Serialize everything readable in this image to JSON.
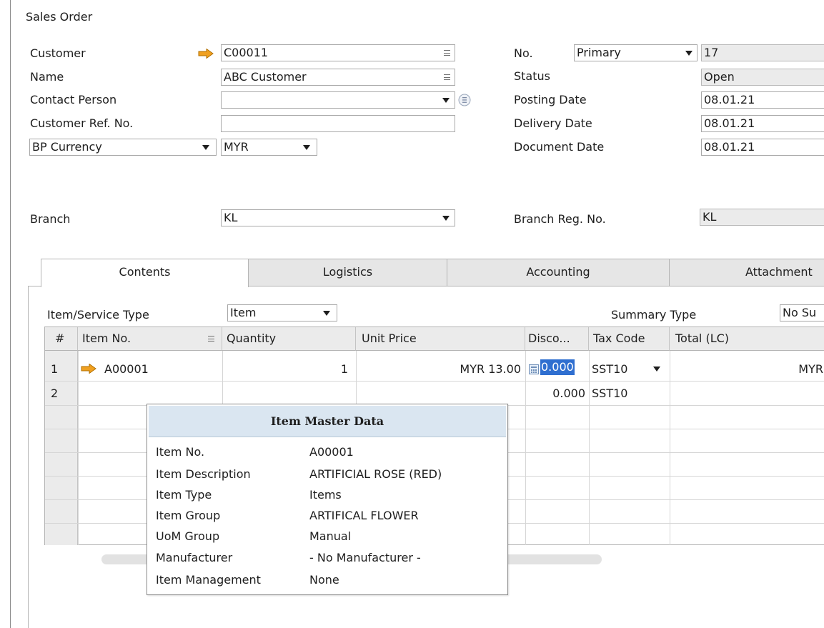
{
  "window": {
    "title": "Sales Order"
  },
  "header": {
    "customer": {
      "label": "Customer",
      "value": "C00011"
    },
    "name": {
      "label": "Name",
      "value": "ABC Customer"
    },
    "contact_person": {
      "label": "Contact Person",
      "value": ""
    },
    "customer_ref": {
      "label": "Customer Ref. No.",
      "value": ""
    },
    "bp_currency": {
      "label": "BP Currency",
      "value": "MYR"
    },
    "branch": {
      "label": "Branch",
      "value": "KL"
    },
    "no": {
      "label": "No.",
      "series": "Primary",
      "value": "17"
    },
    "status": {
      "label": "Status",
      "value": "Open"
    },
    "posting_date": {
      "label": "Posting Date",
      "value": "08.01.21"
    },
    "delivery_date": {
      "label": "Delivery Date",
      "value": "08.01.21"
    },
    "document_date": {
      "label": "Document Date",
      "value": "08.01.21"
    },
    "branch_reg": {
      "label": "Branch Reg. No.",
      "value": "KL"
    }
  },
  "tabs": [
    "Contents",
    "Logistics",
    "Accounting",
    "Attachment"
  ],
  "contents": {
    "item_service_type": {
      "label": "Item/Service Type",
      "value": "Item"
    },
    "summary_type": {
      "label": "Summary Type",
      "value": "No Su"
    }
  },
  "grid": {
    "columns": [
      "#",
      "Item No.",
      "Quantity",
      "Unit Price",
      "Disco...",
      "Tax Code",
      "Total (LC)"
    ],
    "rows": [
      {
        "num": "1",
        "item_no": "A00001",
        "quantity": "1",
        "unit_price": "MYR 13.00",
        "discount": "0.000",
        "tax_code": "SST10",
        "total": "MYR"
      },
      {
        "num": "2",
        "item_no": "",
        "quantity": "",
        "unit_price": "",
        "discount": "0.000",
        "tax_code": "SST10",
        "total": ""
      }
    ]
  },
  "tooltip": {
    "title": "Item Master Data",
    "rows": [
      {
        "key": "Item No.",
        "value": "A00001"
      },
      {
        "key": "Item Description",
        "value": "ARTIFICIAL ROSE (RED)"
      },
      {
        "key": "Item Type",
        "value": "Items"
      },
      {
        "key": "Item Group",
        "value": "ARTIFICAL FLOWER"
      },
      {
        "key": "UoM Group",
        "value": "Manual"
      },
      {
        "key": "Manufacturer",
        "value": "- No Manufacturer -"
      },
      {
        "key": "Item Management",
        "value": "None"
      }
    ]
  },
  "icons": {
    "link_arrow": "orange-link-arrow-icon",
    "list": "list-menu-icon",
    "dropdown": "dropdown-arrow-icon",
    "calculator": "calculator-icon",
    "info": "info-icon"
  },
  "colors": {
    "link_arrow": "#f0a020",
    "tooltip_header": "#dae6f1",
    "selection": "#2f6fd0"
  }
}
